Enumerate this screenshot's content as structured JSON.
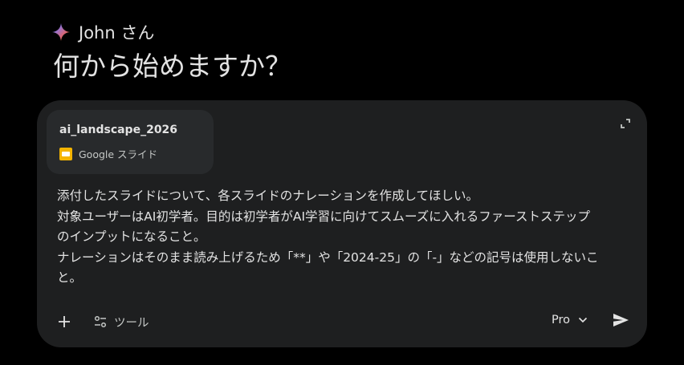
{
  "greeting": {
    "name": "John さん",
    "headline": "何から始めますか？"
  },
  "attachment": {
    "title": "ai_landscape_2026",
    "type_label": "Google スライド",
    "icon": "google-slides-icon"
  },
  "prompt": {
    "lines": [
      "添付したスライドについて、各スライドのナレーションを作成してほしい。",
      "対象ユーザーはAI初学者。目的は初学者がAI学習に向けてスムーズに入れるファーストステップ",
      "のインプットになること。",
      "ナレーションはそのまま読み上げるため「**」や「2024-25」の「-」などの記号は使用しないこ",
      "と。"
    ]
  },
  "toolbar": {
    "tools_label": "ツール",
    "model_label": "Pro"
  },
  "colors": {
    "background": "#000000",
    "composer": "#1e1f20",
    "card": "#282a2c",
    "slides_yellow": "#f4b400"
  }
}
